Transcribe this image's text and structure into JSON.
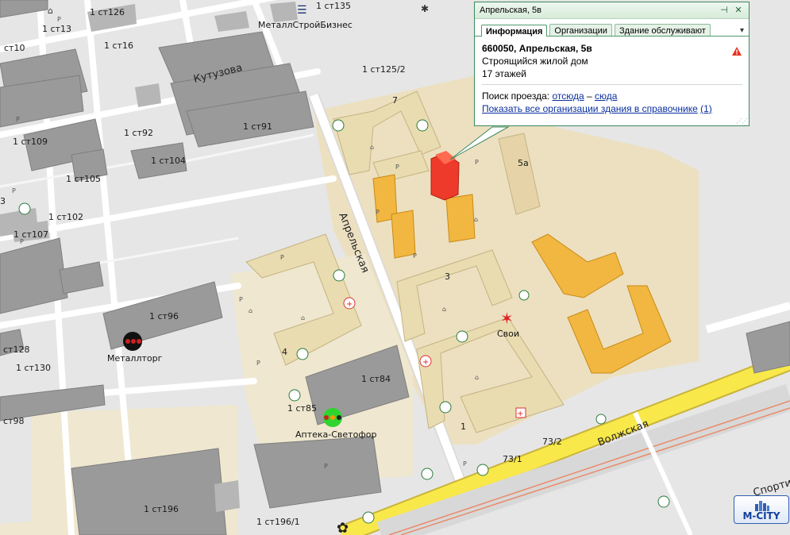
{
  "popup": {
    "title": "Апрельская, 5в",
    "tabs": [
      "Информация",
      "Организации",
      "Здание обслуживают"
    ],
    "more_icon": "chevron-down-icon",
    "address": "660050, Апрельская, 5в",
    "description": "Строящийся жилой дом",
    "floors": "17 этажей",
    "route_label": "Поиск проезда:",
    "route_from": "отсюда",
    "route_dash": "–",
    "route_to": "сюда",
    "show_all_link": "Показать все организации здания в справочнике",
    "show_all_count": "(1)",
    "pin_icon": "pin-icon",
    "close_icon": "close-icon",
    "warning_icon": "warning-icon"
  },
  "streets": {
    "aprelskaya": "Апрельская",
    "kutuzova": "Кутузова",
    "volzhskaya": "Волжская",
    "sport": "Спорти"
  },
  "pois": {
    "metallstroy": "МеталлСтройБизнес",
    "metalltorg": "Металлторг",
    "apteka": "Аптека-Светофор",
    "svoi": "Свои"
  },
  "building_labels": {
    "st135": "1 ст135",
    "st126": "1 ст126",
    "st13": "1 ст13",
    "st10": "ст10",
    "st16": "1 ст16",
    "st125_2": "1 ст125/2",
    "st91": "1 ст91",
    "st92": "1 ст92",
    "st109": "1 ст109",
    "st104": "1 ст104",
    "st105": "1 ст105",
    "st102": "1 ст102",
    "st107": "1 ст107",
    "st96": "1 ст96",
    "st128": "ст128",
    "st130": "1 ст130",
    "st98": "ст98",
    "st84": "1 ст84",
    "st85": "1 ст85",
    "st196": "1 ст196",
    "st196_1": "1 ст196/1",
    "n7": "7",
    "n5a": "5а",
    "n3": "3",
    "n4": "4",
    "n1": "1",
    "n73_2": "73/2",
    "n73_1": "73/1",
    "n3left": "3"
  },
  "logo": "M-CITY",
  "colors": {
    "selected_building": "#ee3a2a",
    "construction": "#f2b740",
    "residential": "#eddcb4",
    "industrial": "#8f8f8f",
    "road_main": "#f8e84a",
    "popup_border": "#3a8a5e"
  }
}
